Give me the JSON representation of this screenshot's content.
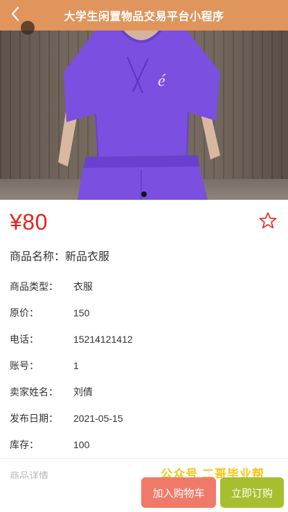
{
  "header": {
    "title": "大学生闲置物品交易平台小程序",
    "back_icon": "chevron-left-icon"
  },
  "carousel": {
    "image_description": "purple t-shirt outfit photo",
    "dot_count": 1,
    "active_index": 0,
    "colors": {
      "shirt": "#7b4fe0",
      "background": "#6f6259"
    }
  },
  "product": {
    "price": "¥80",
    "name_label": "商品名称：",
    "name_value": "新品衣服",
    "favorite_icon": "star-outline-icon"
  },
  "details": [
    {
      "label": "商品类型：",
      "value": "衣服"
    },
    {
      "label": "原价：",
      "value": "150"
    },
    {
      "label": "电话：",
      "value": "15214121412"
    },
    {
      "label": "账号：",
      "value": "1"
    },
    {
      "label": "卖家姓名：",
      "value": "刘倩"
    },
    {
      "label": "发布日期：",
      "value": "2021-05-15"
    },
    {
      "label": "库存：",
      "value": "100"
    }
  ],
  "partial_row_text": "商品详情",
  "watermark": "公众号 二哥毕业帮",
  "actions": {
    "add_to_cart": "加入购物车",
    "buy_now": "立即订购"
  },
  "colors": {
    "header": "#e0955c",
    "price": "#e8231e",
    "cart_button": "#f07a6a",
    "buy_button": "#a7bf2e",
    "watermark": "#f5c518"
  }
}
